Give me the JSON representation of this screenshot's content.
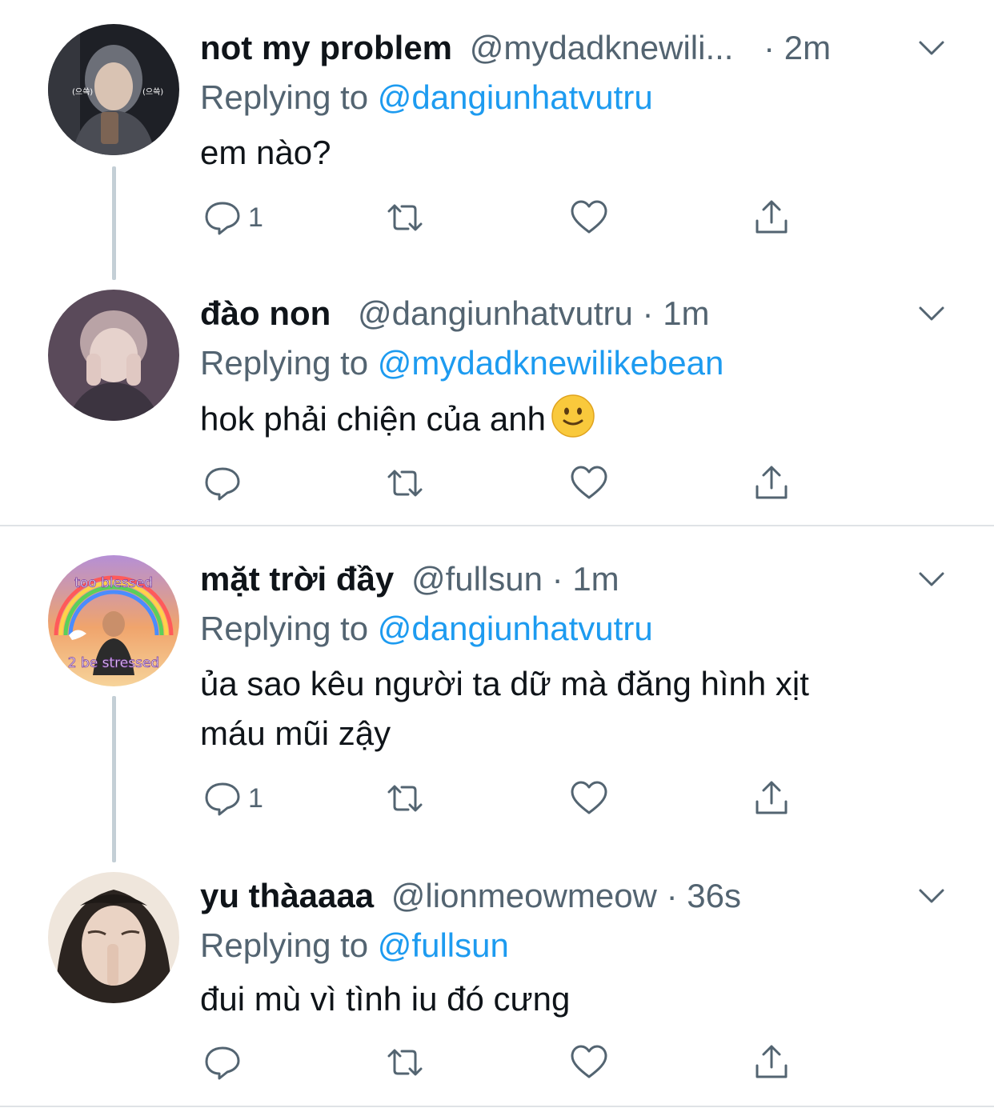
{
  "tweets": [
    {
      "name": "not my problem",
      "handle": "@mydadknewili...",
      "sep": "·",
      "time": "2m",
      "replying_prefix": "Replying to",
      "replying_to": "@dangiunhatvutru",
      "text": "em nào?",
      "reply_count": "1",
      "avatar_colors": [
        "#2b2d33",
        "#6c6f78"
      ]
    },
    {
      "name": "đào non",
      "handle": "@dangiunhatvutru",
      "sep": "·",
      "time": "1m",
      "replying_prefix": "Replying to",
      "replying_to": "@mydadknewilikebean",
      "text": "hok phải chiện của anh",
      "reply_count": "",
      "avatar_colors": [
        "#6a5a66",
        "#c9b0b6"
      ]
    },
    {
      "name": "mặt trời đầy",
      "handle": "@fullsun",
      "sep": "·",
      "time": "1m",
      "replying_prefix": "Replying to",
      "replying_to": "@dangiunhatvutru",
      "text_line1": "ủa sao kêu người ta dữ mà đăng hình xịt",
      "text_line2": "máu mũi zậy",
      "reply_count": "1",
      "avatar_top_text": "too blessed",
      "avatar_bottom_text": "2 be stressed",
      "avatar_colors": [
        "#b88fd8",
        "#f3b36a"
      ]
    },
    {
      "name": "yu thàaaaa",
      "handle": "@lionmeowmeow",
      "sep": "·",
      "time": "36s",
      "replying_prefix": "Replying to",
      "replying_to": "@fullsun",
      "text": "đui mù vì tình iu đó cưng",
      "reply_count": "",
      "avatar_colors": [
        "#2a2420",
        "#e9d6c8"
      ]
    }
  ],
  "icons": {
    "reply": "reply-icon",
    "retweet": "retweet-icon",
    "like": "heart-icon",
    "share": "share-icon",
    "menu": "chevron-down-icon"
  },
  "colors": {
    "link": "#1d9bf0",
    "secondary": "#536471",
    "thread_line": "#c4cfd6"
  }
}
